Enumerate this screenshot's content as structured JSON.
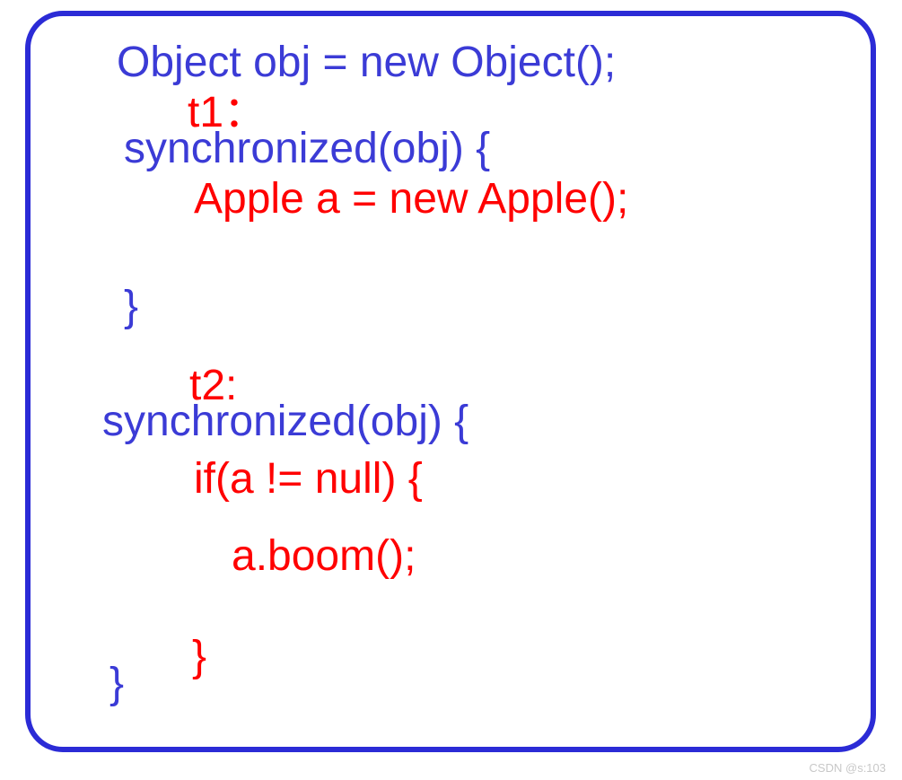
{
  "code": {
    "l1": "Object obj = new Object();",
    "l2": "t1：",
    "l3": "synchronized(obj) {",
    "l4": "Apple a = new Apple();",
    "l5": "}",
    "l6": "t2:",
    "l7": "synchronized(obj) {",
    "l8": "if(a != null) {",
    "l9": "a.boom();",
    "l10": "}",
    "l11": "}"
  },
  "watermark": "CSDN @s:103"
}
